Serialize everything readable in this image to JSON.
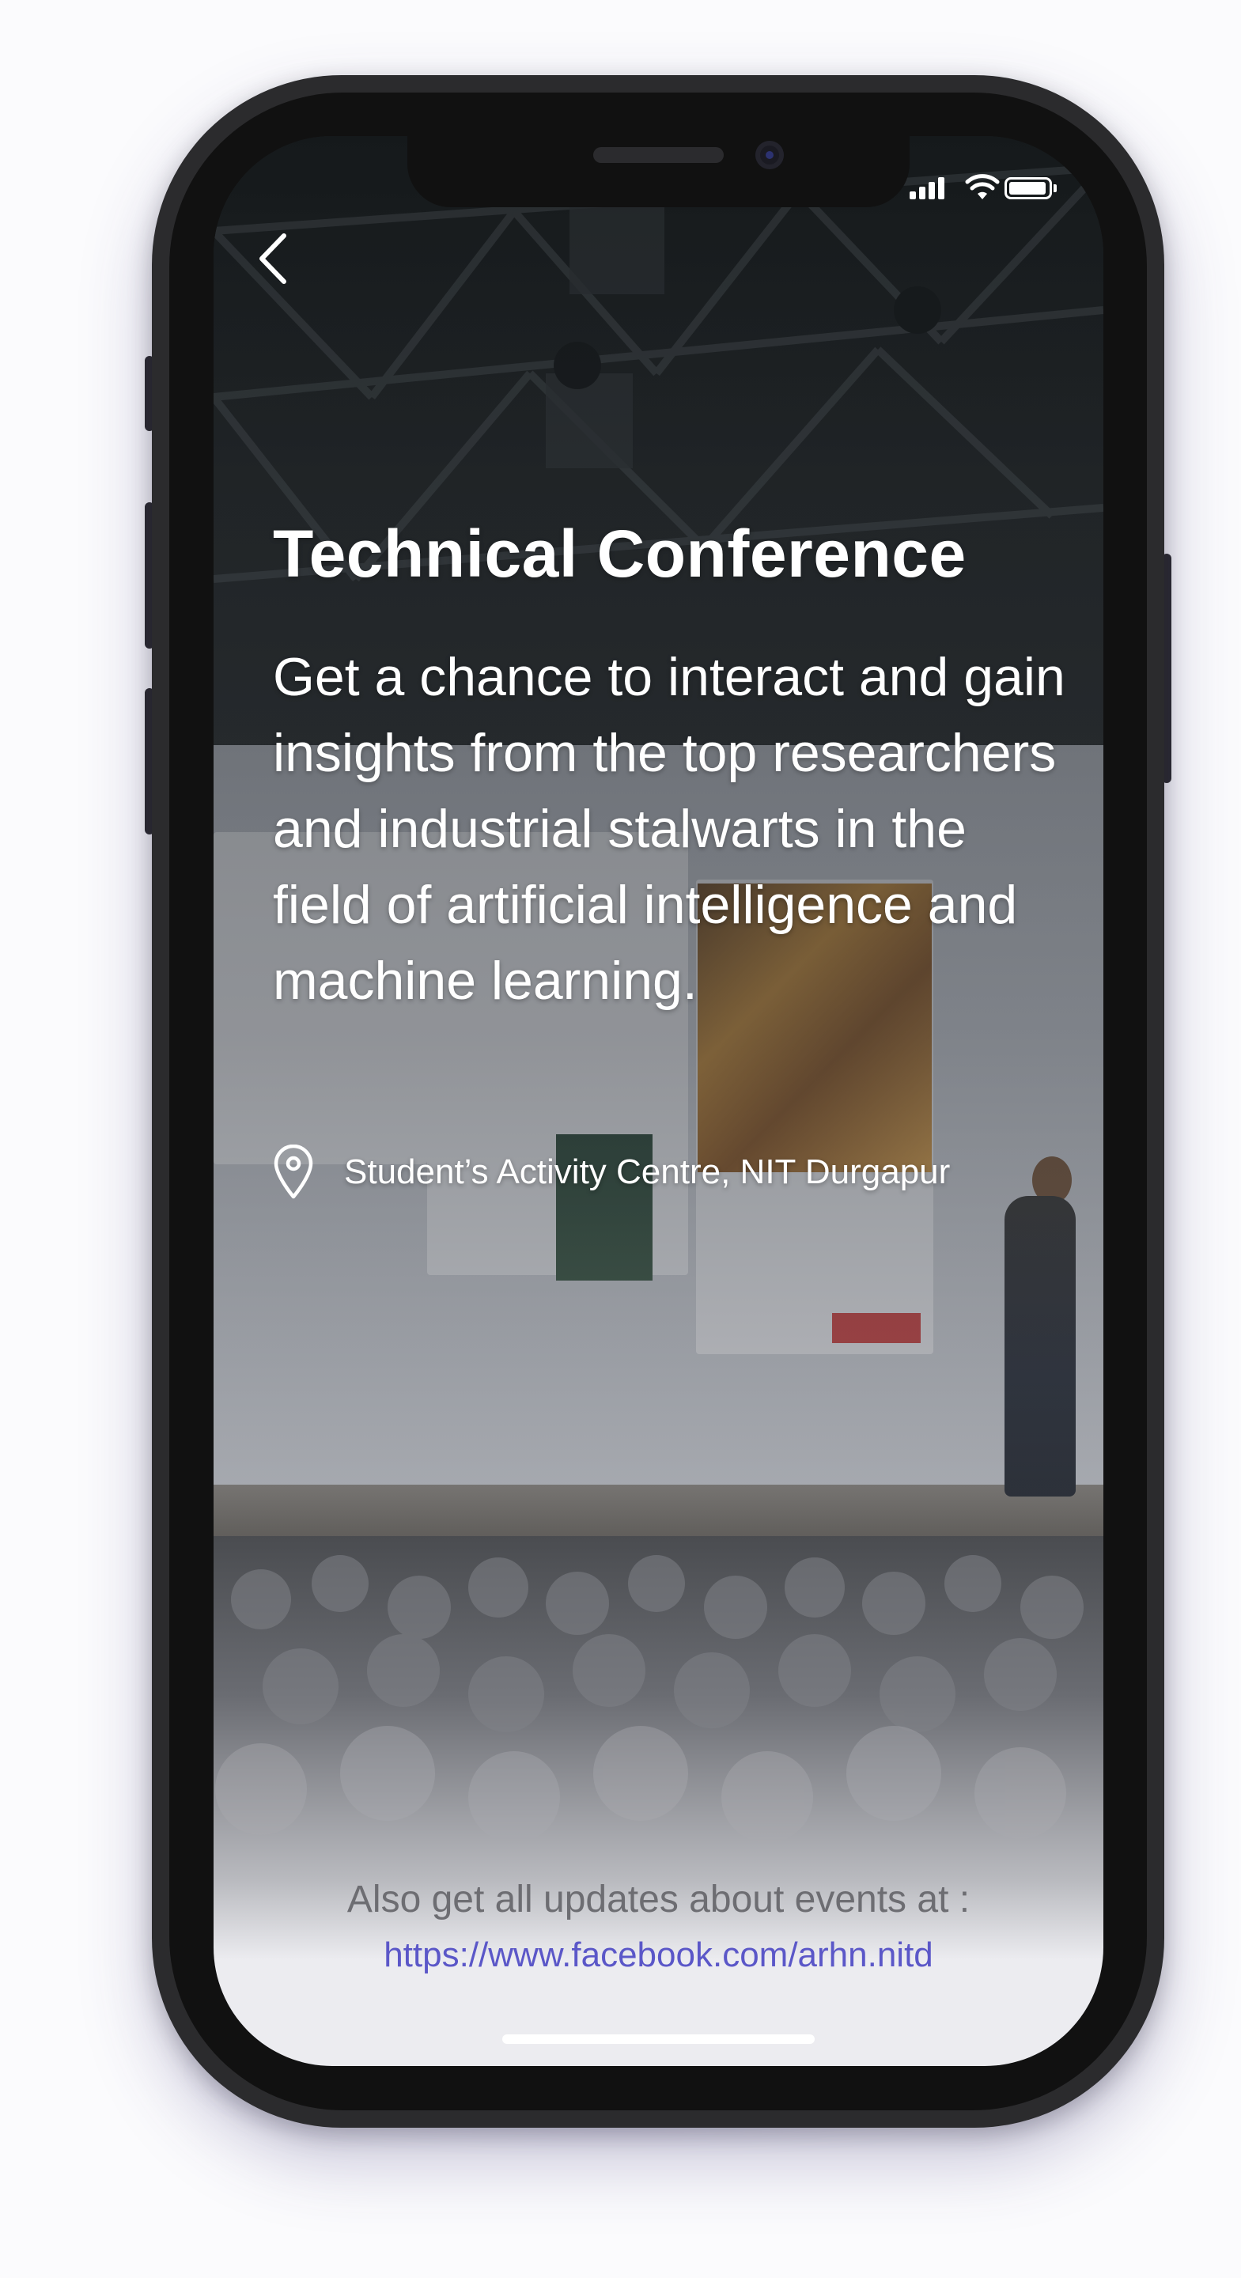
{
  "event": {
    "title": "Technical Conference",
    "description": "Get a chance to interact and gain insights from the top researchers and industrial stalwarts in the field of artificial intelligence and machine learning.",
    "location": "Student’s Activity Centre, NIT Durgapur"
  },
  "footer": {
    "text": "Also get all updates about events at :",
    "link": "https://www.facebook.com/arhn.nitd"
  },
  "icons": {
    "back": "chevron-left-icon",
    "location": "map-pin-icon",
    "signal": "cellular-signal-icon",
    "wifi": "wifi-icon",
    "battery": "battery-icon"
  },
  "colors": {
    "title_text": "#ffffff",
    "link": "#5b57c8",
    "footer_text": "#6d6d72",
    "device_frame": "#2b2b2d"
  }
}
